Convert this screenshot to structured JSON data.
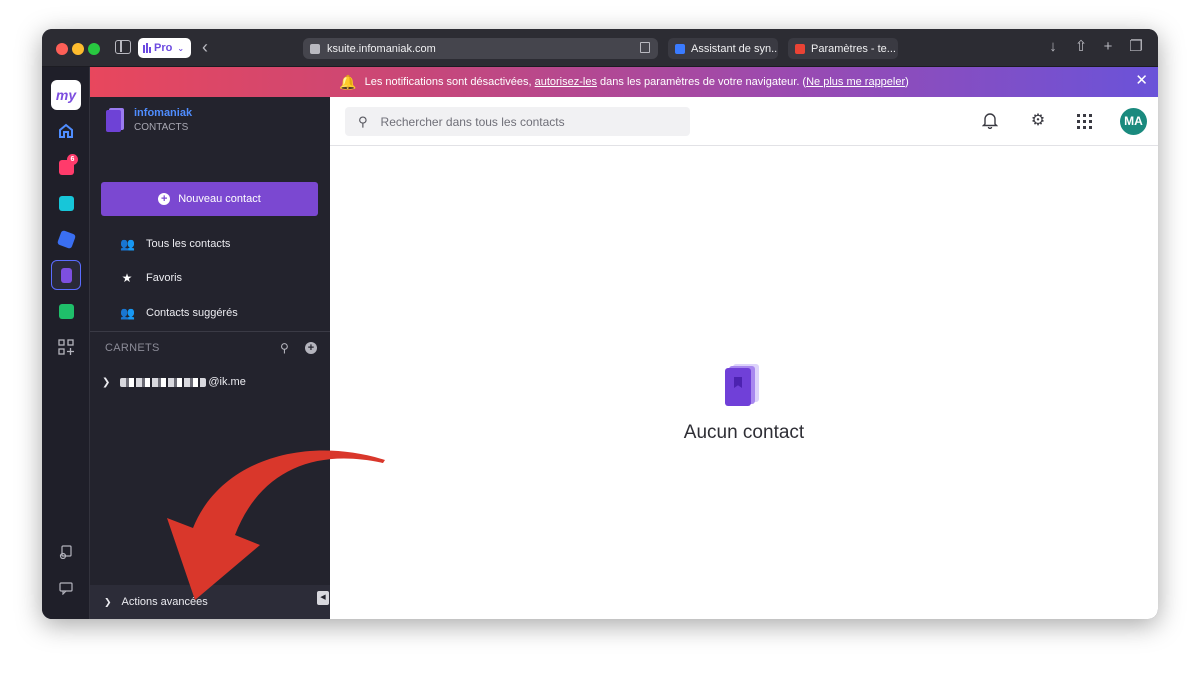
{
  "browser": {
    "profile_label": "Pro",
    "url": "ksuite.infomaniak.com",
    "tabs": [
      {
        "label": "Assistant de syn...",
        "favicon_color": "#3a7bff"
      },
      {
        "label": "Paramètres - te...",
        "favicon_color": "#ea4335"
      }
    ]
  },
  "rail": {
    "my_label": "my",
    "mail_badge": "6",
    "icons": [
      "home-icon",
      "mail-icon",
      "drive-icon",
      "kchat-icon",
      "contacts-icon",
      "calendar-icon",
      "apps-icon",
      "help-icon",
      "chat-icon",
      "support-icon"
    ]
  },
  "banner": {
    "text_before": "Les notifications sont désactivées,",
    "link1": "autorisez-les",
    "text_middle": "dans les paramètres de votre navigateur. (",
    "link2": "Ne plus me rappeler",
    "text_after": ")"
  },
  "sidebar": {
    "brand_name": "infomaniak",
    "brand_sub": "CONTACTS",
    "new_contact_label": "Nouveau contact",
    "nav": [
      {
        "label": "Tous les contacts",
        "icon": "users-icon"
      },
      {
        "label": "Favoris",
        "icon": "star-icon"
      },
      {
        "label": "Contacts suggérés",
        "icon": "suggested-users-icon"
      }
    ],
    "carnets_label": "CARNETS",
    "address_book_suffix": "@ik.me",
    "advanced_label": "Actions avancées"
  },
  "main": {
    "search_placeholder": "Rechercher dans tous les contacts",
    "avatar_initials": "MA",
    "empty_text": "Aucun contact"
  },
  "colors": {
    "accent": "#7b48d1",
    "brand_blue": "#4f8dff",
    "avatar": "#1a8a7e",
    "annotation_arrow": "#d9372b"
  }
}
